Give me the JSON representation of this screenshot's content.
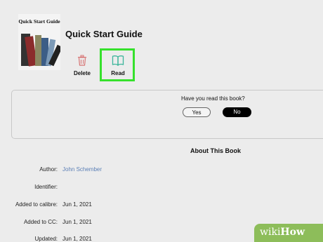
{
  "book": {
    "cover_text": "Quick Start Guide",
    "title": "Quick Start Guide"
  },
  "actions": {
    "delete_label": "Delete",
    "read_label": "Read"
  },
  "prompt": {
    "question": "Have you read this book?",
    "yes_label": "Yes",
    "no_label": "No"
  },
  "about": {
    "heading": "About This Book",
    "rows": [
      {
        "label": "Author:",
        "value": "John Schember"
      },
      {
        "label": "Identifier:",
        "value": ""
      },
      {
        "label": "Added to calibre:",
        "value": "Jun 1, 2021"
      },
      {
        "label": "Added to CC:",
        "value": "Jun 1, 2021"
      },
      {
        "label": "Updated:",
        "value": "Jun 1, 2021"
      }
    ]
  },
  "watermark": {
    "wiki": "wiki",
    "how": "How"
  },
  "colors": {
    "highlight": "#36e12c",
    "delete": "#d77373",
    "read": "#3bb59a",
    "link": "#5b7fb6"
  }
}
